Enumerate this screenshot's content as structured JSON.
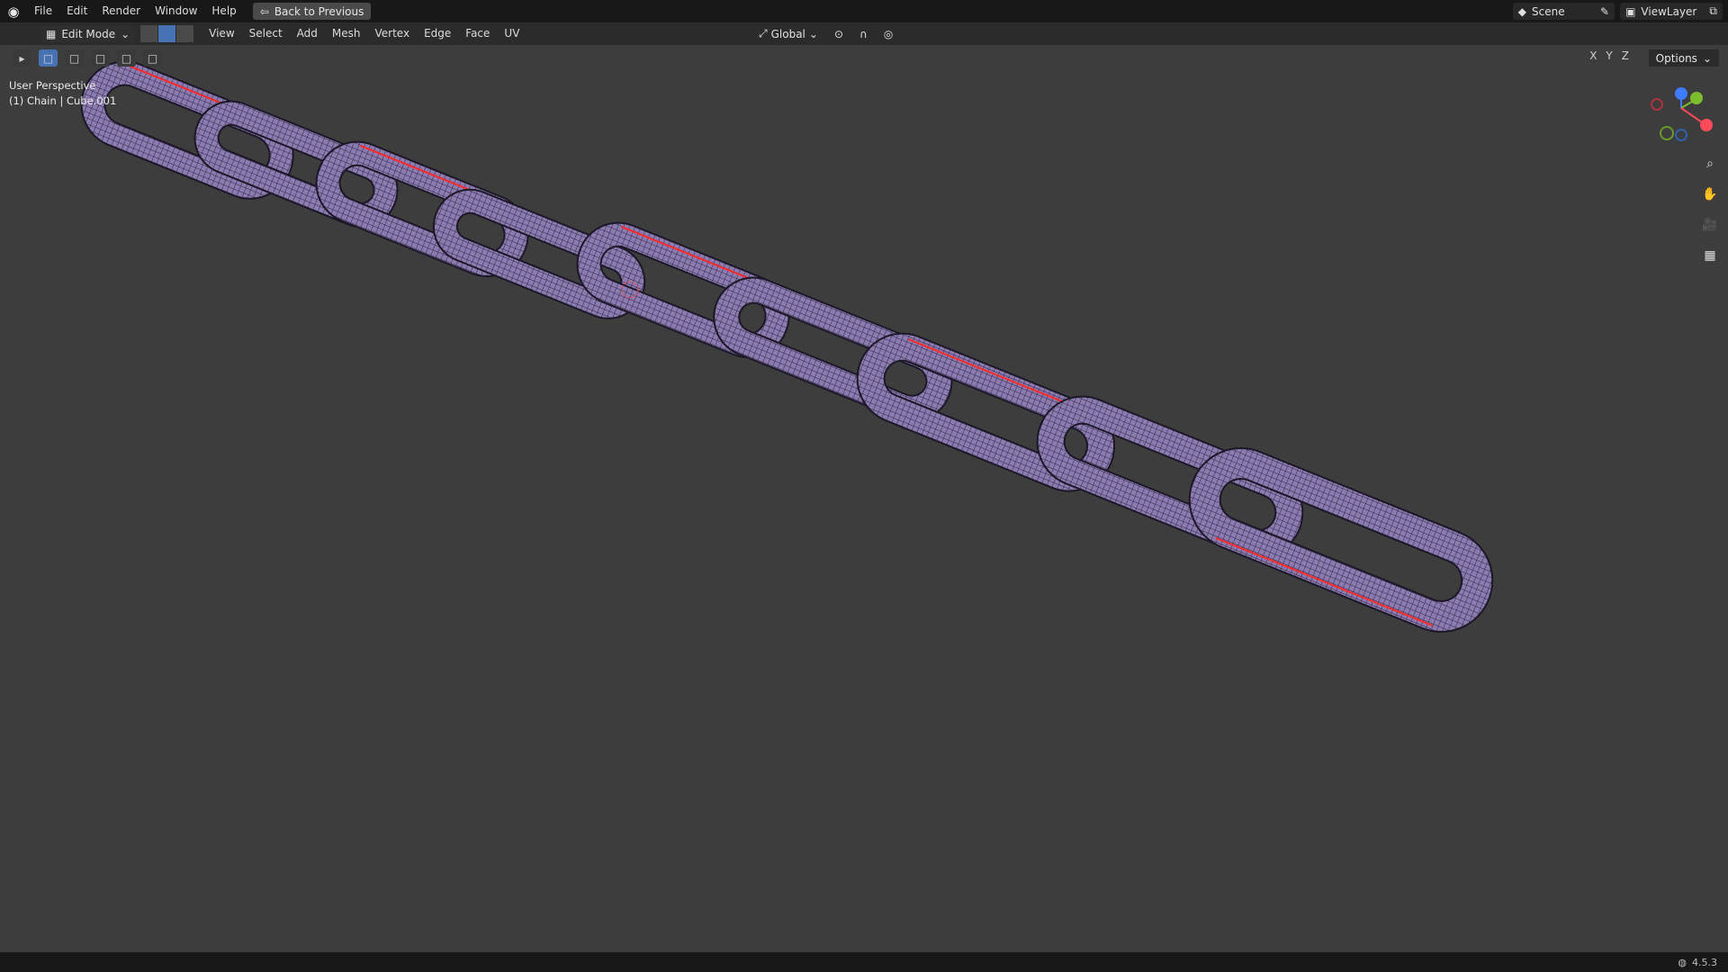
{
  "top_menu": {
    "items": [
      "File",
      "Edit",
      "Render",
      "Window",
      "Help"
    ],
    "back_button": "Back to Previous",
    "scene": "Scene",
    "view_layer": "ViewLayer"
  },
  "header": {
    "mode": "Edit Mode",
    "menus": [
      "View",
      "Select",
      "Add",
      "Mesh",
      "Vertex",
      "Edge",
      "Face",
      "UV"
    ],
    "transform_orientation": "Global",
    "options_label": "Options",
    "axes": [
      "X",
      "Y",
      "Z"
    ]
  },
  "viewport": {
    "perspective_label": "User Perspective",
    "object_label": "(1) Chain | Cube.001"
  },
  "status_bar": {
    "version": "4.5.3"
  },
  "colors": {
    "chain": "#8b7bb0",
    "seam": "#ff2a2a",
    "accent": "#4772b3"
  }
}
